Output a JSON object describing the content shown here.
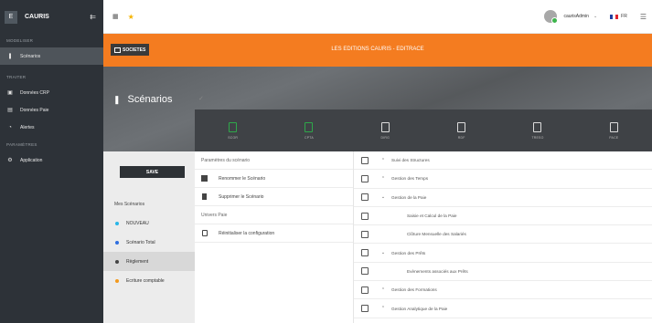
{
  "brand": {
    "badge": "E",
    "name": "CAURIS"
  },
  "sidebar": {
    "sections": [
      {
        "title": "MODELISER",
        "items": [
          {
            "label": "Scénarios",
            "icon": "scenario-icon",
            "active": true
          }
        ]
      },
      {
        "title": "TRAITER",
        "items": [
          {
            "label": "Données CRP",
            "icon": "data-icon"
          },
          {
            "label": "Données Paie",
            "icon": "payroll-icon"
          },
          {
            "label": "Alertes",
            "icon": "alert-icon"
          }
        ]
      },
      {
        "title": "PARAMÈTRES",
        "items": [
          {
            "label": "Application",
            "icon": "settings-icon"
          }
        ]
      }
    ]
  },
  "topbar": {
    "user": "caurisAdmin",
    "lang": "FR"
  },
  "org_bar": {
    "button": "SOCIETES",
    "title": "LES EDITIONS CAURIS - EDITRACE"
  },
  "page": {
    "title": "Scénarios"
  },
  "tools": [
    {
      "label": "SCOR",
      "color": "green"
    },
    {
      "label": "CPTA",
      "color": "green"
    },
    {
      "label": "DIRG",
      "color": "white"
    },
    {
      "label": "RDF",
      "color": "white"
    },
    {
      "label": "TRESO",
      "color": "white"
    },
    {
      "label": "PACE",
      "color": "white"
    }
  ],
  "left": {
    "save": "SAVE",
    "my_scenarios": "Mes Scénarios",
    "scenarios": [
      {
        "label": "NOUVEAU",
        "color": "#29b6e8"
      },
      {
        "label": "Scénario Total",
        "color": "#2f6fe0"
      },
      {
        "label": "Règlement",
        "color": "#444444"
      },
      {
        "label": "Ecriture comptable",
        "color": "#f39a1e"
      }
    ]
  },
  "middle": {
    "param_title": "Paramètres du scénario",
    "rename": "Renommer le Scénario",
    "delete": "Supprimer le Scénario",
    "univers_title": "Univers Paie",
    "reset": "Réinitialiser la configuration"
  },
  "tree": [
    {
      "label": "Suivi des Structures",
      "chevron": "up",
      "child": false
    },
    {
      "label": "Gestion des Temps",
      "chevron": "up",
      "child": false
    },
    {
      "label": "Gestion de la Paie",
      "chevron": "down",
      "child": false
    },
    {
      "label": "Saisie et Calcul de la Paie",
      "chevron": "",
      "child": true
    },
    {
      "label": "Clôture Mensuelle des Salariés",
      "chevron": "",
      "child": true
    },
    {
      "label": "Gestion des Prêts",
      "chevron": "down",
      "child": false
    },
    {
      "label": "Evènements associés aux Prêts",
      "chevron": "",
      "child": true
    },
    {
      "label": "Gestion des Formations",
      "chevron": "up",
      "child": false
    },
    {
      "label": "Gestion Analytique de la Paie",
      "chevron": "up",
      "child": false
    }
  ]
}
